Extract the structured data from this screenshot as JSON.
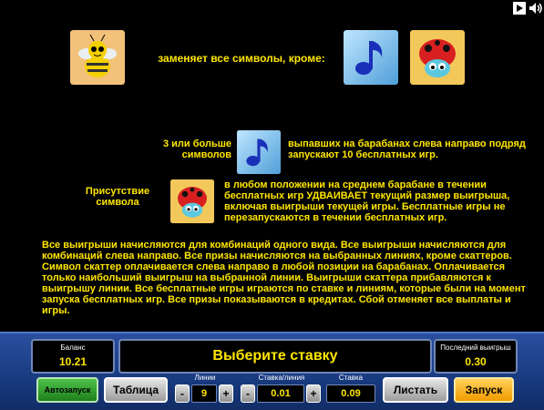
{
  "rules": {
    "wild_text": "заменяет все символы, кроме:",
    "scatter_count_label": "3 или больше символов",
    "scatter_text": "выпавших на барабанах слева направо подряд запускают 10 бесплатных игр.",
    "presence_label": "Присутствие символа",
    "presence_text": "в любом положении на среднем барабане в течении бесплатных игр УДВАИВАЕТ текущий размер выигрыша, включая выигрыши текущей игры. Бесплатные игры не перезапускаются в течении бесплатных игр.",
    "general_text": "Все выигрыши начисляются для комбинаций одного вида. Все выигрыши начисляются для комбинаций слева направо. Все призы начисляются на выбранных линиях, кроме скаттеров. Символ скаттер оплачивается слева направо в любой позиции на барабанах. Оплачивается только наибольший выигрыш на выбранной линии. Выигрыши скаттера прибавляются к выигрышу линии. Все бесплатные игры играются по ставке и линиям, которые были на момент запуска бесплатных игр. Все призы показываются в кредитах. Сбой отменяет все выплаты и игры."
  },
  "symbols": {
    "wild": "bee-icon",
    "scatter": "music-note-icon",
    "bonus": "ladybug-icon"
  },
  "panel": {
    "balance_label": "Баланс",
    "balance_value": "10.21",
    "message": "Выберите ставку",
    "last_win_label": "Последний выигрыш",
    "last_win_value": "0.30",
    "autoplay_label": "Автозапуск",
    "paytable_label": "Таблица",
    "lines_label": "Линии",
    "lines_value": "9",
    "bet_per_line_label": "Ставка/линия",
    "bet_per_line_value": "0.01",
    "bet_label": "Ставка",
    "bet_value": "0.09",
    "page_label": "Листать",
    "start_label": "Запуск",
    "minus": "-",
    "plus": "+"
  },
  "colors": {
    "text_yellow": "#ffe600",
    "panel_blue": "#1c3f88"
  }
}
